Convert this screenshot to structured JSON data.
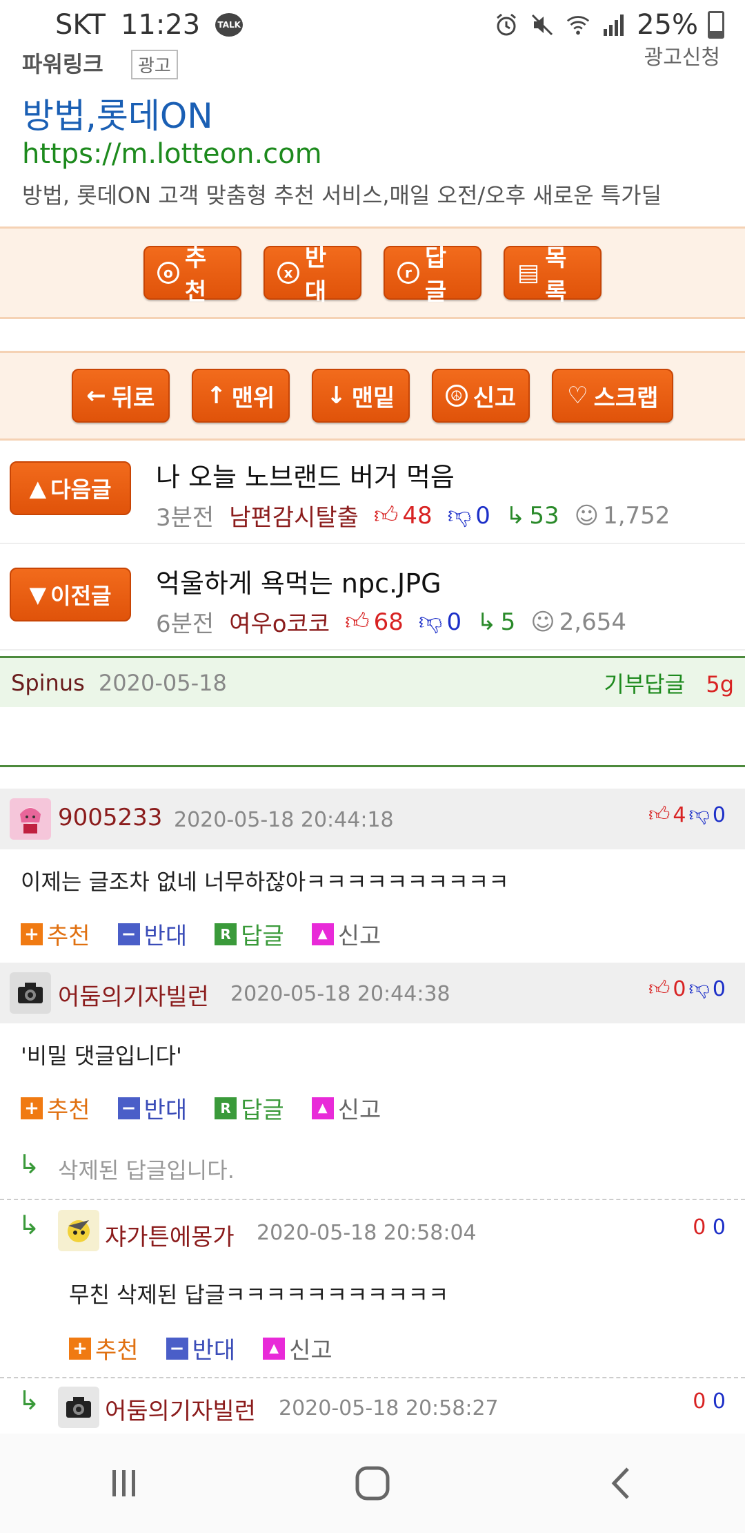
{
  "status": {
    "carrier": "SKT",
    "time": "11:23",
    "talk": "TALK",
    "battery": "25%"
  },
  "ad": {
    "label": "파워링크",
    "tag": "광고",
    "request": "광고신청",
    "title": "방법,롯데ON",
    "url": "https://m.lotteon.com",
    "desc": "방법, 롯데ON 고객 맞춤형 추천 서비스,매일 오전/오후 새로운 특가딜"
  },
  "actions1": {
    "recommend": "추천",
    "oppose": "반대",
    "reply": "답글",
    "list": "목록"
  },
  "actions2": {
    "back": "뒤로",
    "top": "맨위",
    "bottom": "맨밑",
    "report": "신고",
    "scrap": "스크랩"
  },
  "next_post": {
    "button": "다음글",
    "title": "나 오늘 노브랜드 버거 먹음",
    "ago": "3분전",
    "author": "남편감시탈출",
    "up": "48",
    "down": "0",
    "replies": "53",
    "views": "1,752"
  },
  "prev_post": {
    "button": "이전글",
    "title": "억울하게 욕먹는 npc.JPG",
    "ago": "6분전",
    "author": "여우o코코",
    "up": "68",
    "down": "0",
    "replies": "5",
    "views": "2,654"
  },
  "author_bar": {
    "name": "Spinus",
    "date": "2020-05-18",
    "donate": "기부답글",
    "gold": "5g"
  },
  "comment_labels": {
    "up": "추천",
    "down": "반대",
    "reply": "답글",
    "report": "신고"
  },
  "comments": [
    {
      "name": "9005233",
      "date": "2020-05-18 20:44:18",
      "up": "4",
      "down": "0",
      "body": "이제는 글조차 없네 너무하잖아ㅋㅋㅋㅋㅋㅋㅋㅋㅋㅋ"
    },
    {
      "name": "어둠의기자빌런",
      "date": "2020-05-18 20:44:38",
      "up": "0",
      "down": "0",
      "body": "'비밀 댓글입니다'"
    }
  ],
  "deleted_reply": "삭제된 답글입니다.",
  "replies": [
    {
      "name": "쟈가튼에몽가",
      "date": "2020-05-18 20:58:04",
      "up": "0",
      "down": "0",
      "body": "무친 삭제된 답글ㅋㅋㅋㅋㅋㅋㅋㅋㅋㅋㅋ"
    },
    {
      "name": "어둠의기자빌런",
      "date": "2020-05-18 20:58:27",
      "up": "0",
      "down": "0"
    }
  ]
}
